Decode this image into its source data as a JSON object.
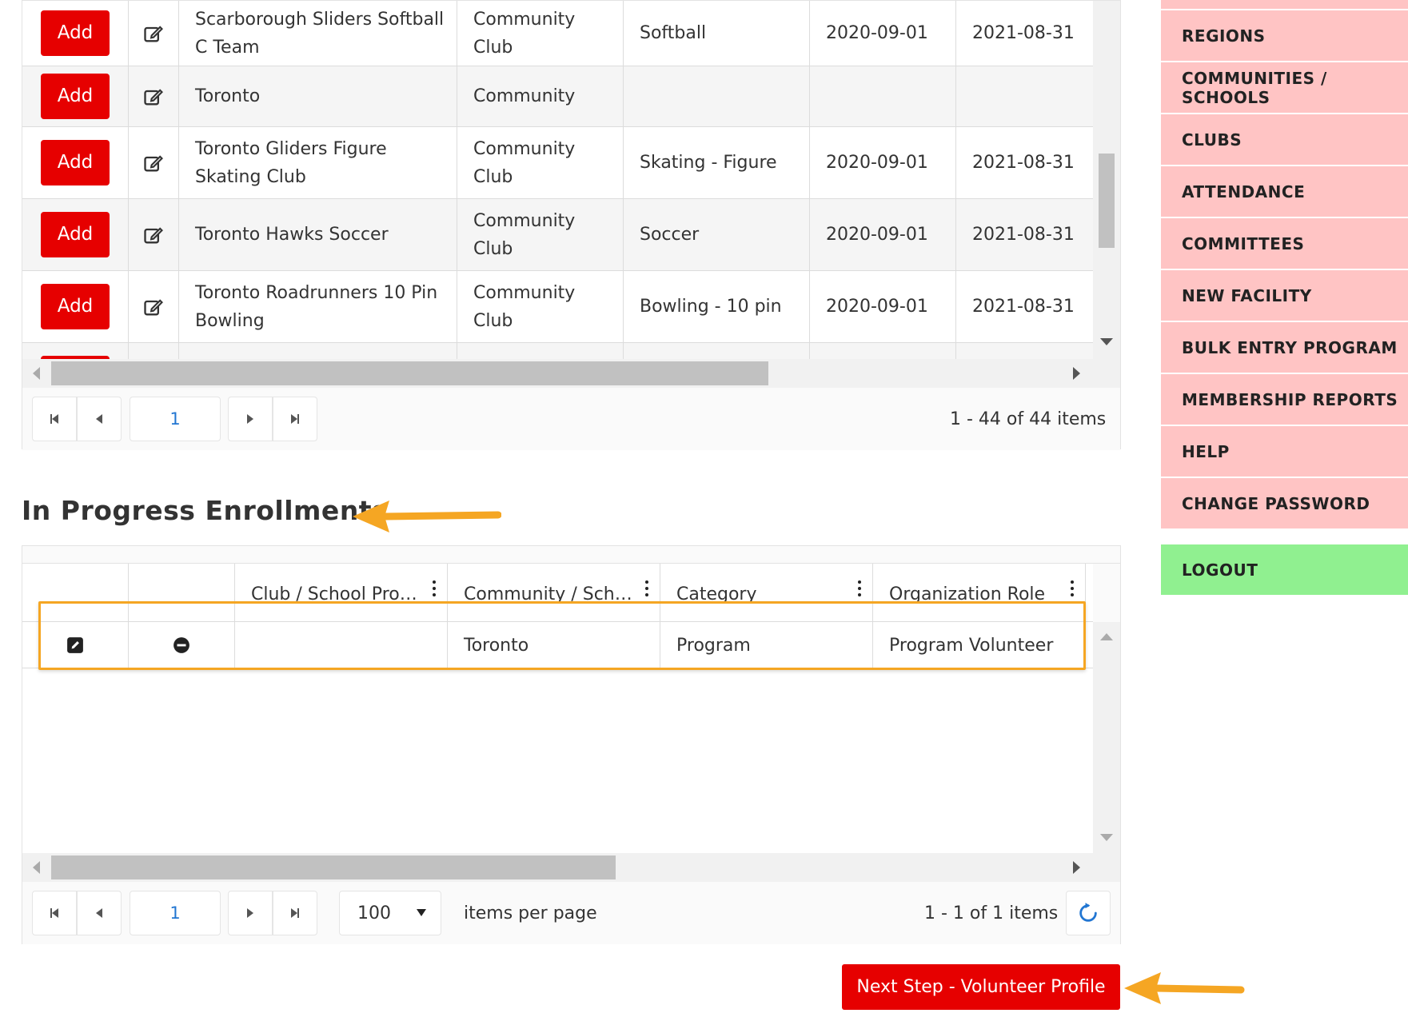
{
  "top_grid": {
    "add_label": "Add",
    "rows": [
      {
        "name_line1": "Scarborough Sliders Softball",
        "name_line2": "C Team",
        "type_line1": "Community",
        "type_line2": "Club",
        "sport": "Softball",
        "start": "2020-09-01",
        "end": "2021-08-31"
      },
      {
        "name_line1": "Toronto",
        "name_line2": "",
        "type_line1": "Community",
        "type_line2": "",
        "sport": "",
        "start": "",
        "end": ""
      },
      {
        "name_line1": "Toronto Gliders Figure",
        "name_line2": "Skating Club",
        "type_line1": "Community",
        "type_line2": "Club",
        "sport": "Skating - Figure",
        "start": "2020-09-01",
        "end": "2021-08-31"
      },
      {
        "name_line1": "Toronto Hawks Soccer",
        "name_line2": "",
        "type_line1": "Community",
        "type_line2": "Club",
        "sport": "Soccer",
        "start": "2020-09-01",
        "end": "2021-08-31"
      },
      {
        "name_line1": "Toronto Roadrunners 10 Pin",
        "name_line2": "Bowling",
        "type_line1": "Community",
        "type_line2": "Club",
        "sport": "Bowling - 10 pin",
        "start": "2020-09-01",
        "end": "2021-08-31"
      }
    ],
    "pager": {
      "page": "1",
      "info": "1 - 44 of 44 items"
    }
  },
  "sidebar": {
    "items": [
      {
        "label": "REGIONS"
      },
      {
        "label": "COMMUNITIES / SCHOOLS"
      },
      {
        "label": "CLUBS"
      },
      {
        "label": "ATTENDANCE"
      },
      {
        "label": "COMMITTEES"
      },
      {
        "label": "NEW FACILITY"
      },
      {
        "label": "BULK ENTRY PROGRAM"
      },
      {
        "label": "MEMBERSHIP REPORTS"
      },
      {
        "label": "HELP"
      },
      {
        "label": "CHANGE PASSWORD"
      }
    ],
    "logout": "LOGOUT"
  },
  "in_progress": {
    "title": "In Progress Enrollments",
    "columns": [
      "Club / School Pro…",
      "Community / Sch…",
      "Category",
      "Organization Role"
    ],
    "row": {
      "program": "",
      "community": "Toronto",
      "category": "Program",
      "role": "Program Volunteer"
    },
    "pager": {
      "page": "1",
      "page_size": "100",
      "items_per_page": "items per page",
      "info": "1 - 1 of 1 items"
    }
  },
  "next_button": "Next Step - Volunteer Profile",
  "colors": {
    "add_red": "#e60000",
    "sidebar_pink": "#ffc4c4",
    "logout_green": "#90f090",
    "arrow_orange": "#f5a623",
    "link_blue": "#2276d2"
  }
}
